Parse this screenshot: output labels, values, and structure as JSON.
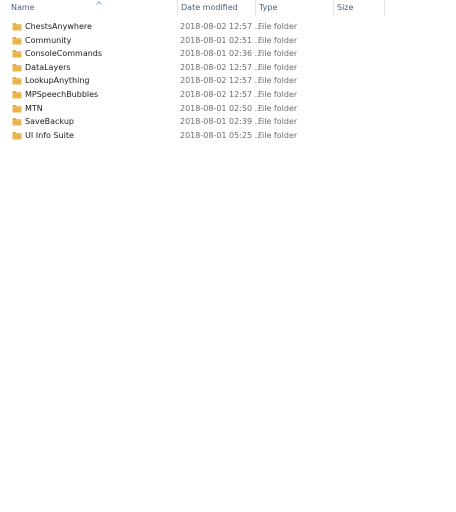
{
  "columns": {
    "name": "Name",
    "date_modified": "Date modified",
    "type": "Type",
    "size": "Size"
  },
  "sort": {
    "column": "name",
    "direction": "ascending",
    "icon": "sort-up-chevron-icon"
  },
  "colors": {
    "header_text": "#4c607a",
    "folder": "#e8b44a",
    "folder_tab": "#d49a2a",
    "secondary_text": "#6d6d6d"
  },
  "rows": [
    {
      "name": "ChestsAnywhere",
      "date": "2018-08-02 12:57 ...",
      "type": "File folder",
      "size": "",
      "icon": "folder-icon"
    },
    {
      "name": "Community",
      "date": "2018-08-01 02:51 ...",
      "type": "File folder",
      "size": "",
      "icon": "folder-icon"
    },
    {
      "name": "ConsoleCommands",
      "date": "2018-08-01 02:36 ...",
      "type": "File folder",
      "size": "",
      "icon": "folder-icon"
    },
    {
      "name": "DataLayers",
      "date": "2018-08-02 12:57 ...",
      "type": "File folder",
      "size": "",
      "icon": "folder-icon"
    },
    {
      "name": "LookupAnything",
      "date": "2018-08-02 12:57 ...",
      "type": "File folder",
      "size": "",
      "icon": "folder-icon"
    },
    {
      "name": "MPSpeechBubbles",
      "date": "2018-08-02 12:57 ...",
      "type": "File folder",
      "size": "",
      "icon": "folder-icon"
    },
    {
      "name": "MTN",
      "date": "2018-08-01 02:50 ...",
      "type": "File folder",
      "size": "",
      "icon": "folder-icon"
    },
    {
      "name": "SaveBackup",
      "date": "2018-08-01 02:39 ...",
      "type": "File folder",
      "size": "",
      "icon": "folder-icon"
    },
    {
      "name": "UI Info Suite",
      "date": "2018-08-01 05:25 ...",
      "type": "File folder",
      "size": "",
      "icon": "folder-icon"
    }
  ]
}
